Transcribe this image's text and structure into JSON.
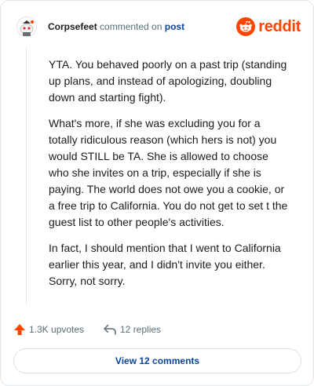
{
  "header": {
    "username": "Corpsefeet",
    "action_text": "commented on",
    "post_link": "post",
    "brand": "reddit"
  },
  "comment": {
    "paragraphs": [
      "YTA. You behaved poorly on a past trip (standing up plans, and instead of apologizing, doubling down and starting fight).",
      "What's more, if she was excluding you for a totally ridiculous reason (which hers is not) you would STILL be TA. She is allowed to choose who she invites on a trip, especially if she is paying. The world does not owe you a cookie, or a free trip to California. You do not get to set t the guest list to other people's activities.",
      "In fact, I should mention that I went to California earlier this year, and I didn't invite you either. Sorry, not sorry."
    ]
  },
  "actions": {
    "upvotes": "1.3K upvotes",
    "replies": "12 replies"
  },
  "cta": {
    "label": "View 12 comments"
  },
  "icons": {
    "avatar": "snoo-avatar-icon",
    "brand": "reddit-logo-icon",
    "upvote": "upvote-arrow-icon",
    "reply": "reply-arrow-icon"
  },
  "colors": {
    "brand": "#ff4500",
    "link": "#0a449b",
    "muted": "#576f76",
    "text": "#1c1c1c"
  }
}
